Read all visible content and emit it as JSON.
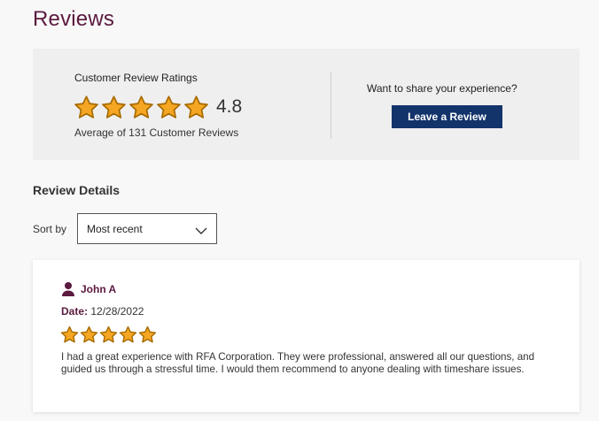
{
  "header": {
    "title": "Reviews"
  },
  "summary": {
    "ratings_label": "Customer Review Ratings",
    "rating_value": "4.8",
    "stars": 5,
    "average_text": "Average of 131 Customer Reviews",
    "share_prompt": "Want to share your experience?",
    "leave_review_label": "Leave a Review"
  },
  "details": {
    "heading": "Review Details",
    "sort_label": "Sort by",
    "sort_value": "Most recent"
  },
  "reviews": [
    {
      "name": "John A",
      "date_label": "Date:",
      "date": "12/28/2022",
      "stars": 5,
      "text": "I had a great experience with RFA Corporation. They were professional, answered all our questions, and guided us through a stressful time. I would them recommend to anyone dealing with timeshare issues."
    }
  ],
  "colors": {
    "title": "#5b1a3f",
    "button": "#13336b",
    "star_fill": "#f5a623",
    "star_stroke": "#a66a00"
  },
  "icons": {
    "star": "star-icon",
    "user": "user-icon",
    "chevron": "chevron-down-icon"
  }
}
